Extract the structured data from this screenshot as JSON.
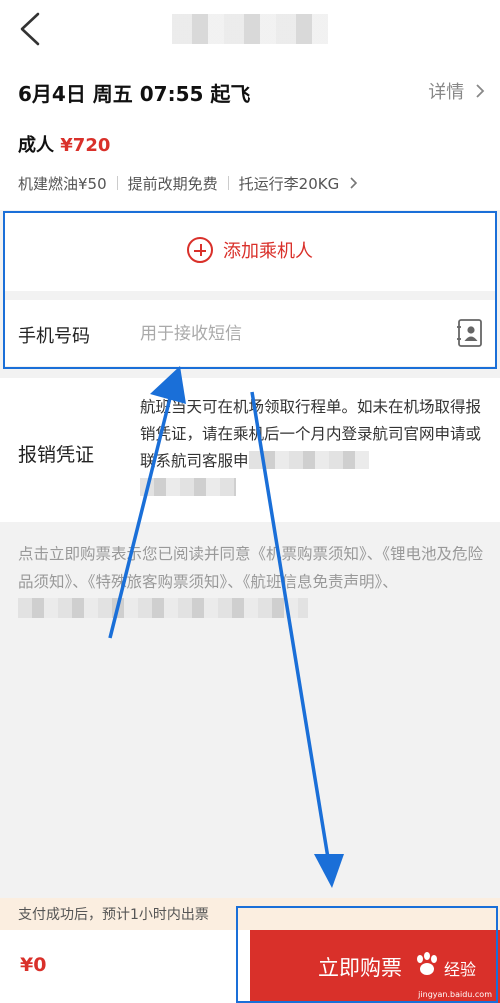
{
  "header": {
    "back_icon": "chevron-left-icon"
  },
  "flight": {
    "date_time": "6月4日 周五 07:55 起飞",
    "detail_label": "详情",
    "detail_icon": "chevron-right-icon",
    "passenger_type": "成人",
    "price": "¥720",
    "tags": [
      "机建燃油¥50",
      "提前改期免费",
      "托运行李20KG"
    ],
    "tags_icon": "chevron-right-icon"
  },
  "passenger": {
    "add_label": "添加乘机人",
    "add_icon": "plus-circle-icon"
  },
  "phone": {
    "label": "手机号码",
    "placeholder": "用于接收短信",
    "contact_icon": "contact-book-icon"
  },
  "invoice": {
    "label": "报销凭证",
    "text": "航班当天可在机场领取行程单。如未在机场取得报销凭证，请在乘机后一个月内登录航司官网申请或联系航司客服申"
  },
  "notice": {
    "text": "点击立即购票表示您已阅读并同意《机票购票须知》、《锂电池及危险品须知》、《特殊旅客购票须知》、《航班信息免责声明》、"
  },
  "tip": {
    "text": "支付成功后，预计1小时内出票"
  },
  "footer": {
    "total": "¥0",
    "buy_label": "立即购票"
  },
  "watermark": {
    "logo": "经验",
    "site": "jingyan.baidu.com"
  },
  "colors": {
    "accent_red": "#d9302a",
    "annotation_blue": "#1a6fd8",
    "tip_bg": "#fbeee0"
  }
}
